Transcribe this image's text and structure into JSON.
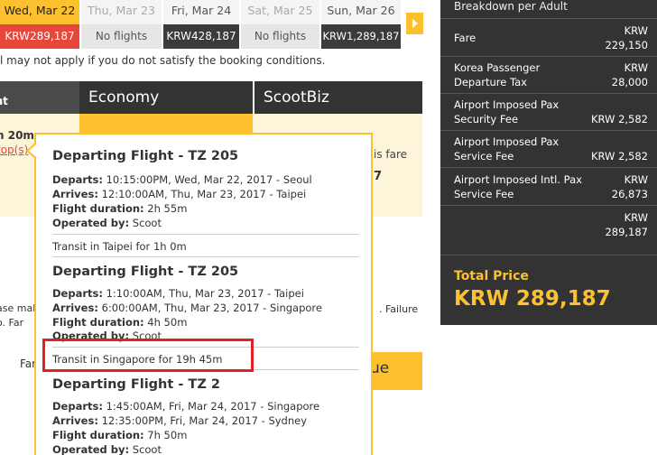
{
  "dates": [
    {
      "day": "Wed, Mar 22",
      "price": "KRW289,187",
      "state": "selected"
    },
    {
      "day": "Thu, Mar 23",
      "price": "No flights",
      "state": "none"
    },
    {
      "day": "Fri, Mar 24",
      "price": "KRW428,187",
      "state": "available"
    },
    {
      "day": "Sat, Mar 25",
      "price": "No flights",
      "state": "none"
    },
    {
      "day": "Sun, Mar 26",
      "price": "KRW1,289,187",
      "state": "available"
    }
  ],
  "conditions_text": "l may not apply if you do not satisfy the booking conditions.",
  "table": {
    "col_flight": "ght",
    "col_economy": "Economy",
    "col_scootbiz": "ScootBiz",
    "duration": "h 20m",
    "stops": "top(s)",
    "sb_note": "is fare",
    "sb_price": "7",
    "warn_a": "ase mal",
    "warn_b": "o. Far",
    "warn_right": ". Failure",
    "fare_label": "Far",
    "select_text": "ue"
  },
  "tooltip": {
    "segments": [
      {
        "title": "Departing Flight - TZ 205",
        "departs_label": "Departs:",
        "departs": "10:15:00PM, Wed, Mar 22, 2017 - Seoul",
        "arrives_label": "Arrives:",
        "arrives": "12:10:00AM, Thu, Mar 23, 2017 - Taipei",
        "duration_label": "Flight duration:",
        "duration": "2h 55m",
        "operated_label": "Operated by:",
        "operated": "Scoot"
      },
      {
        "title": "Departing Flight - TZ 205",
        "departs_label": "Departs:",
        "departs": "1:10:00AM, Thu, Mar 23, 2017 - Taipei",
        "arrives_label": "Arrives:",
        "arrives": "6:00:00AM, Thu, Mar 23, 2017 - Singapore",
        "duration_label": "Flight duration:",
        "duration": "4h 50m",
        "operated_label": "Operated by:",
        "operated": "Scoot"
      },
      {
        "title": "Departing Flight - TZ 2",
        "departs_label": "Departs:",
        "departs": "1:45:00AM, Fri, Mar 24, 2017 - Singapore",
        "arrives_label": "Arrives:",
        "arrives": "12:35:00PM, Fri, Mar 24, 2017 - Sydney",
        "duration_label": "Flight duration:",
        "duration": "7h 50m",
        "operated_label": "Operated by:",
        "operated": "Scoot"
      }
    ],
    "transits": [
      "Transit in Taipei for 1h 0m",
      "Transit in Singapore for 19h 45m"
    ]
  },
  "breakdown": {
    "heading": "Breakdown per Adult",
    "rows": [
      {
        "label1": "Fare",
        "label2": "",
        "currency": "KRW",
        "amount": "229,150"
      },
      {
        "label1": "Korea Passenger",
        "label2": "Departure Tax",
        "currency": "KRW",
        "amount": "28,000"
      },
      {
        "label1": "Airport Imposed Pax",
        "label2": "Security Fee",
        "currency": "",
        "amount": "KRW 2,582"
      },
      {
        "label1": "Airport Imposed Pax",
        "label2": "Service Fee",
        "currency": "",
        "amount": "KRW 2,582"
      },
      {
        "label1": "Airport Imposed Intl. Pax",
        "label2": "Service Fee",
        "currency": "KRW",
        "amount": "26,873"
      },
      {
        "label1": "",
        "label2": "",
        "currency": "KRW",
        "amount": "289,187"
      }
    ],
    "total_label": "Total Price",
    "total_value": "KRW 289,187"
  },
  "colors": {
    "accent": "#fdc02f",
    "selected_price": "#e6473a",
    "dark": "#333333",
    "highlight": "#e22028"
  }
}
